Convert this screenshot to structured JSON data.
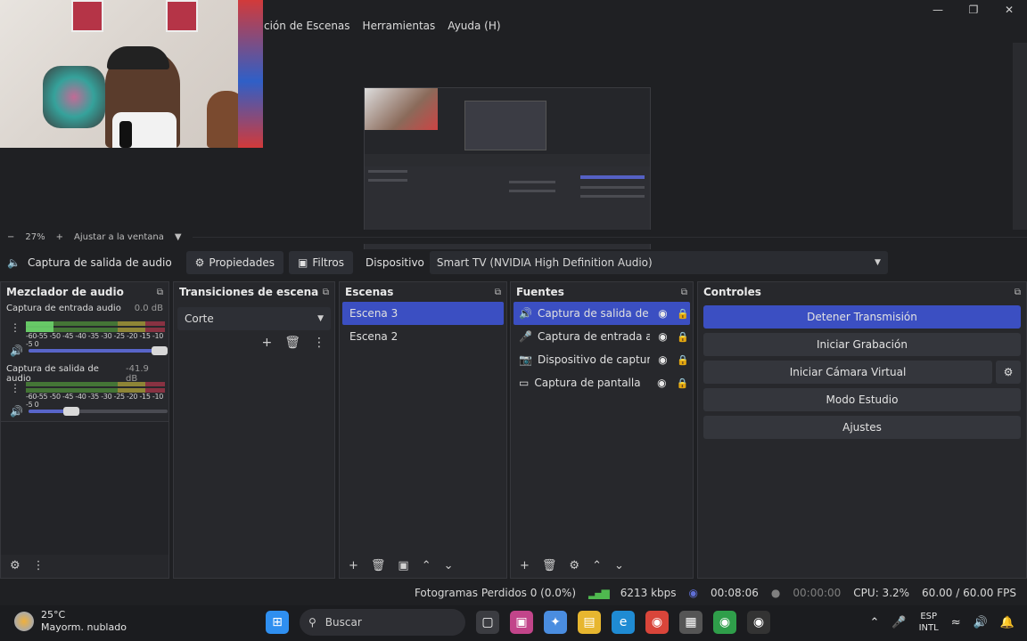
{
  "menu": [
    "ción de Escenas",
    "Herramientas",
    "Ayuda (H)"
  ],
  "zoom": {
    "level": "27%",
    "fit_label": "Ajustar a la ventana"
  },
  "source_toolbar": {
    "source_name": "Captura de salida de audio",
    "properties_label": "Propiedades",
    "filters_label": "Filtros",
    "device_label": "Dispositivo",
    "device_value": "Smart TV (NVIDIA High Definition Audio)"
  },
  "mixer": {
    "title": "Mezclador de audio",
    "scale": "-60-55 -50 -45 -40 -35 -30 -25 -20 -15 -10 -5 0",
    "channels": [
      {
        "name": "Captura de entrada audio",
        "db": "0.0 dB",
        "volume_fraction": 1.0,
        "level_fraction": 0.2
      },
      {
        "name": "Captura de salida de audio",
        "db": "-41.9 dB",
        "volume_fraction": 0.28,
        "level_fraction": 0.0
      }
    ]
  },
  "transitions": {
    "title": "Transiciones de escena",
    "selected": "Corte"
  },
  "scenes": {
    "title": "Escenas",
    "items": [
      {
        "name": "Escena 3",
        "active": true
      },
      {
        "name": "Escena 2",
        "active": false
      }
    ]
  },
  "sources": {
    "title": "Fuentes",
    "items": [
      {
        "name": "Captura de salida de aud",
        "icon": "speaker-icon",
        "active": true
      },
      {
        "name": "Captura de entrada audi",
        "icon": "microphone-icon",
        "active": false
      },
      {
        "name": "Dispositivo de captura de",
        "icon": "camera-icon",
        "active": false
      },
      {
        "name": "Captura de pantalla",
        "icon": "monitor-icon",
        "active": false
      }
    ]
  },
  "controls": {
    "title": "Controles",
    "stop_stream": "Detener Transmisión",
    "start_recording": "Iniciar Grabación",
    "start_virtual_cam": "Iniciar Cámara Virtual",
    "studio_mode": "Modo Estudio",
    "settings": "Ajustes"
  },
  "status": {
    "dropped_frames": "Fotogramas Perdidos 0 (0.0%)",
    "bitrate": "6213 kbps",
    "stream_time": "00:08:06",
    "record_time": "00:00:00",
    "cpu": "CPU: 3.2%",
    "fps": "60.00 / 60.00 FPS"
  },
  "taskbar": {
    "temperature": "25°C",
    "weather": "Mayorm. nublado",
    "search_placeholder": "Buscar",
    "lang_top": "ESP",
    "lang_bottom": "INTL"
  },
  "colors": {
    "accent": "#3b4fc2",
    "panel": "#27282c",
    "background": "#1f2023"
  }
}
